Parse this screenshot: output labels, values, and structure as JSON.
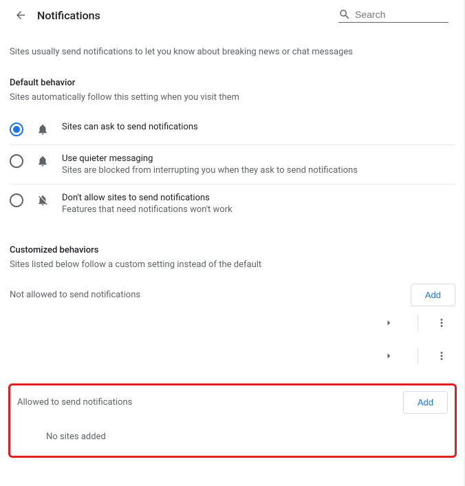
{
  "header": {
    "title": "Notifications",
    "search_placeholder": "Search"
  },
  "intro": "Sites usually send notifications to let you know about breaking news or chat messages",
  "default_behavior": {
    "title": "Default behavior",
    "subtitle": "Sites automatically follow this setting when you visit them",
    "options": [
      {
        "label": "Sites can ask to send notifications",
        "description": "",
        "selected": true
      },
      {
        "label": "Use quieter messaging",
        "description": "Sites are blocked from interrupting you when they ask to send notifications",
        "selected": false
      },
      {
        "label": "Don't allow sites to send notifications",
        "description": "Features that need notifications won't work",
        "selected": false
      }
    ]
  },
  "custom": {
    "title": "Customized behaviors",
    "subtitle": "Sites listed below follow a custom setting instead of the default"
  },
  "not_allowed": {
    "title": "Not allowed to send notifications",
    "add_label": "Add"
  },
  "allowed": {
    "title": "Allowed to send notifications",
    "add_label": "Add",
    "empty": "No sites added"
  }
}
